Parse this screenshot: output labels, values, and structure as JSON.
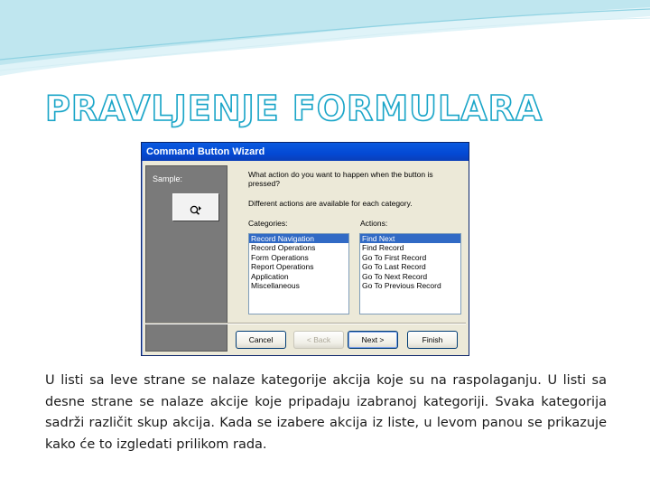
{
  "slide": {
    "title": "PRAVLJENJE FORMULARA",
    "body": "U listi sa leve strane se nalaze kategorije akcija koje su na raspolaganju. U listi sa desne strane se nalaze akcije koje pripadaju izabranoj kategoriji. Svaka kategorija sadrži različit skup akcija. Kada se izabere akcija iz liste, u levom panou se prikazuje kako će to izgledati prilikom rada."
  },
  "colors": {
    "title_outline": "#1aa5c8",
    "banner": "#bfe6ef",
    "titlebar": "#0449d4",
    "selection": "#316ac5"
  },
  "dialog": {
    "title": "Command Button Wizard",
    "sample_label": "Sample:",
    "sample_icon": "arrow-button-icon",
    "prompt": "What action do you want to happen when the button is pressed?",
    "info": "Different actions are available for each category.",
    "categories_label": "Categories:",
    "actions_label": "Actions:",
    "categories": [
      {
        "label": "Record Navigation",
        "selected": true
      },
      {
        "label": "Record Operations",
        "selected": false
      },
      {
        "label": "Form Operations",
        "selected": false
      },
      {
        "label": "Report Operations",
        "selected": false
      },
      {
        "label": "Application",
        "selected": false
      },
      {
        "label": "Miscellaneous",
        "selected": false
      }
    ],
    "actions": [
      {
        "label": "Find Next",
        "selected": true
      },
      {
        "label": "Find Record",
        "selected": false
      },
      {
        "label": "Go To First Record",
        "selected": false
      },
      {
        "label": "Go To Last Record",
        "selected": false
      },
      {
        "label": "Go To Next Record",
        "selected": false
      },
      {
        "label": "Go To Previous Record",
        "selected": false
      }
    ],
    "buttons": {
      "cancel": "Cancel",
      "back": "< Back",
      "next": "Next >",
      "finish": "Finish"
    }
  }
}
